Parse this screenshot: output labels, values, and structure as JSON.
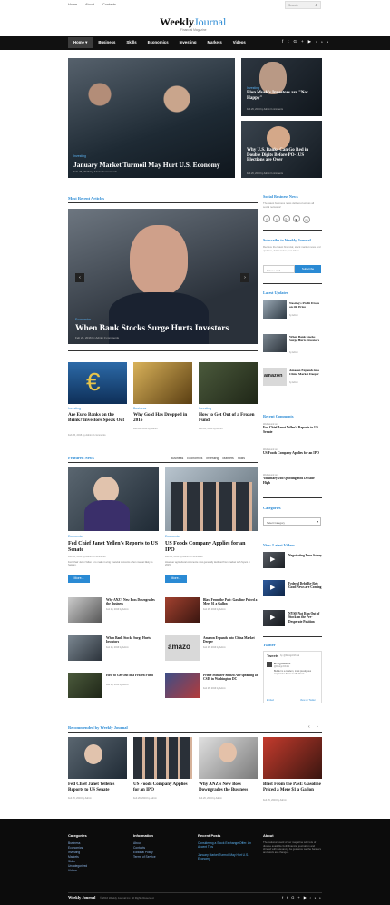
{
  "topnav": [
    "Home",
    "About",
    "Contacts"
  ],
  "search_placeholder": "Search",
  "logo": {
    "w1": "Weekly",
    "w2": "Journal",
    "tagline": "Financial Magazine"
  },
  "nav": [
    "Home",
    "Business",
    "Skills",
    "Economics",
    "Investing",
    "Markets",
    "Videos"
  ],
  "social": [
    "f",
    "t",
    "G+",
    "▶",
    "rss"
  ],
  "hero_main": {
    "tag": "Investing",
    "title": "January Market Turmoil May Hurt U.S. Economy",
    "meta": "Feb 26, 2016   by Admin   0 comments"
  },
  "hero_top": {
    "tag": "Investing",
    "title": "Elon Musk's Investors are \"Not Happy\"",
    "meta": "Feb 26, 2016   by Admin   0 comments"
  },
  "hero_bottom": {
    "tag": "Investing",
    "title": "Why U.S. Banks Can Go Red in Double Digits Before PO-1US Elections are Over",
    "meta": "Feb 26, 2016   by Admin   0 comments"
  },
  "recent": {
    "title": "Most Recent Articles",
    "tag": "Economics",
    "headline": "When Bank Stocks Surge Hurts Investors",
    "meta": "Feb 26, 2016   by Admin   0 comments"
  },
  "cards": [
    {
      "tag": "Investing",
      "title": "Are Euro Banks on the Brink? Investors Speak Out",
      "meta": "Feb 26, 2016   by Admin   0 comments"
    },
    {
      "tag": "Business",
      "title": "Why Gold Has Dropped in 2016",
      "meta": "Feb 26, 2016   by Admin"
    },
    {
      "tag": "Investing",
      "title": "How to Get Out of a Frozen Fund",
      "meta": "Feb 26, 2016   by Admin"
    }
  ],
  "featured": {
    "title": "Featured News",
    "tabs": [
      "Business",
      "Economics",
      "Investing",
      "Markets",
      "Skills"
    ],
    "left": {
      "tag": "Economics",
      "title": "Fed Chief Janet Yellen's Reports to US Senate",
      "meta": "Feb 26, 2016   by Admin   0 comments",
      "text": "Fed Chair Janet Yellen is to make it a big financial concerns when market likely to happen.",
      "more": "More..."
    },
    "right": {
      "tag": "Economics",
      "title": "US Foods Company Applies for an IPO",
      "meta": "Feb 26, 2016   by Admin   0 comments",
      "text": "However agricultural commerce now generally declined from market with Sysco in 2015.",
      "more": "More..."
    },
    "list": [
      {
        "title": "Why ANZ's New Boss Downgrades the Business",
        "meta": "Feb 26, 2016   by Admin"
      },
      {
        "title": "Blast From the Past: Gasoline Priced a Mere $1 a Gallon",
        "meta": "Feb 26, 2016   by Admin"
      },
      {
        "title": "When Bank Stocks Surge Hurts Investors",
        "meta": "Feb 26, 2016   by Admin"
      },
      {
        "title": "Amazon Expands into China Market Deeper",
        "meta": "Feb 26, 2016   by Admin"
      },
      {
        "title": "How to Get Out of a Frozen Fund",
        "meta": "Feb 26, 2016   by Admin"
      },
      {
        "title": "Prime Minister Shinzo Abe speaking at CSIS in Washington DC",
        "meta": "Feb 26, 2016   by Admin"
      }
    ]
  },
  "recommended": {
    "title": "Recommended by Weekly Journal",
    "items": [
      {
        "title": "Fed Chief Janet Yellen's Reports to US Senate",
        "meta": "Feb 26, 2016   by Admin"
      },
      {
        "title": "US Foods Company Applies for an IPO",
        "meta": "Feb 26, 2016   by Admin"
      },
      {
        "title": "Why ANZ's New Boss Downgrades the Business",
        "meta": "Feb 26, 2016   by Admin"
      },
      {
        "title": "Blast From the Past: Gasoline Priced a Mere $1 a Gallon",
        "meta": "Feb 26, 2016   by Admin"
      }
    ]
  },
  "sidebar": {
    "social": {
      "title": "Social Business News",
      "text": "The latest business news delivered across all social networks!"
    },
    "subscribe": {
      "title": "Subscribe to Weekly Journal",
      "text": "Receive the latest financial, stock market news and updates, delivered to your inbox.",
      "placeholder": "Enter e-mail",
      "button": "Subscribe"
    },
    "updates": {
      "title": "Latest Updates",
      "items": [
        {
          "title": "Nasdaq's Profit Drops on Oil Price",
          "meta": "by Admin"
        },
        {
          "title": "When Bank Stocks Surge Hurts Investors",
          "meta": "by Admin"
        },
        {
          "title": "Amazon Expands into China Market Deeper",
          "meta": "by Admin"
        }
      ]
    },
    "comments": {
      "title": "Recent Comments",
      "items": [
        {
          "who": "WebSound on",
          "title": "Fed Chief Janet Yellen's Reports to US Senate"
        },
        {
          "who": "WebSound on",
          "title": "US Foods Company Applies for an IPO"
        },
        {
          "who": "WebSound on",
          "title": "Voluntary Job Quitting Hits Decade High"
        }
      ]
    },
    "categories": {
      "title": "Categories",
      "select": "Select Category"
    },
    "videos": {
      "title": "View Latest Videos",
      "items": [
        {
          "title": "Negotiating Your Salary",
          "meta": "by Admin"
        },
        {
          "title": "Federal Debt Re-Ref: Good News are Coming",
          "meta": "by Admin"
        },
        {
          "title": "NYSE Not Run Out of Stock on the Pre-Desperate Position",
          "meta": "by Admin"
        }
      ]
    },
    "twitter": {
      "title": "Twitter",
      "tweets": "Tweets",
      "by": "by @DesignOrbital",
      "name": "DesignOrbital",
      "handle": "@DesignOrbital",
      "text": "Builder is a modern, most prestigious responsive theme to the finest.",
      "embed": "Embed",
      "view": "View on Twitter"
    }
  },
  "footer": {
    "cols": [
      {
        "title": "Categories",
        "items": [
          "Business",
          "Economics",
          "Investing",
          "Markets",
          "Skills",
          "Uncategorized",
          "Videos"
        ]
      },
      {
        "title": "Information",
        "items": [
          "About",
          "Contacts",
          "Editorial Policy",
          "Terms of Service"
        ]
      },
      {
        "title": "Recent Posts",
        "items": [
          "Considering a Stock Exchange Offer: An Accent Tips",
          "January Market Turmoil May Hurt U.S. Economy"
        ]
      },
      {
        "title": "About",
        "text": "The national board of our magazine with lots of diverse available both financial journalism and shrewd with relevancy. As guidance we the banners and stock are changes."
      }
    ],
    "brand": "Weekly Journal",
    "copyright": "© 2016 Weekly Journal Inc. All Rights Reserved."
  }
}
